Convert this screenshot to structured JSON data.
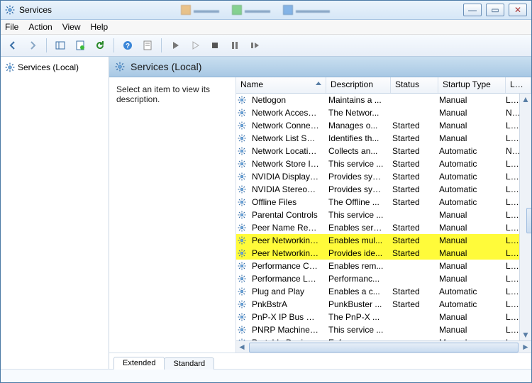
{
  "title": "Services",
  "menubar": [
    "File",
    "Action",
    "View",
    "Help"
  ],
  "tree": {
    "root": "Services (Local)"
  },
  "header": "Services (Local)",
  "desc": "Select an item to view its description.",
  "columns": [
    "Name",
    "Description",
    "Status",
    "Startup Type",
    "Log On As"
  ],
  "tabs": {
    "extended": "Extended",
    "standard": "Standard"
  },
  "services": [
    {
      "name": "Netlogon",
      "desc": "Maintains a ...",
      "status": "",
      "startup": "Manual",
      "logon": "Local Syste...",
      "hl": false
    },
    {
      "name": "Network Access P...",
      "desc": "The Networ...",
      "status": "",
      "startup": "Manual",
      "logon": "Network S...",
      "hl": false
    },
    {
      "name": "Network Connecti...",
      "desc": "Manages o...",
      "status": "Started",
      "startup": "Manual",
      "logon": "Local Syste...",
      "hl": false
    },
    {
      "name": "Network List Service",
      "desc": "Identifies th...",
      "status": "Started",
      "startup": "Manual",
      "logon": "Local Service",
      "hl": false
    },
    {
      "name": "Network Location ...",
      "desc": "Collects an...",
      "status": "Started",
      "startup": "Automatic",
      "logon": "Network S...",
      "hl": false
    },
    {
      "name": "Network Store Int...",
      "desc": "This service ...",
      "status": "Started",
      "startup": "Automatic",
      "logon": "Local Service",
      "hl": false
    },
    {
      "name": "NVIDIA Display Dri...",
      "desc": "Provides sys...",
      "status": "Started",
      "startup": "Automatic",
      "logon": "Local Syste...",
      "hl": false
    },
    {
      "name": "NVIDIA Stereosco...",
      "desc": "Provides sys...",
      "status": "Started",
      "startup": "Automatic",
      "logon": "Local Syste...",
      "hl": false
    },
    {
      "name": "Offline Files",
      "desc": "The Offline ...",
      "status": "Started",
      "startup": "Automatic",
      "logon": "Local Syste...",
      "hl": false
    },
    {
      "name": "Parental Controls",
      "desc": "This service ...",
      "status": "",
      "startup": "Manual",
      "logon": "Local Service",
      "hl": false
    },
    {
      "name": "Peer Name Resolu...",
      "desc": "Enables serv...",
      "status": "Started",
      "startup": "Manual",
      "logon": "Local Service",
      "hl": false
    },
    {
      "name": "Peer Networking ...",
      "desc": "Enables mul...",
      "status": "Started",
      "startup": "Manual",
      "logon": "Local Service",
      "hl": true
    },
    {
      "name": "Peer Networking I...",
      "desc": "Provides ide...",
      "status": "Started",
      "startup": "Manual",
      "logon": "Local Service",
      "hl": true
    },
    {
      "name": "Performance Cou...",
      "desc": "Enables rem...",
      "status": "",
      "startup": "Manual",
      "logon": "Local Service",
      "hl": false
    },
    {
      "name": "Performance Logs...",
      "desc": "Performanc...",
      "status": "",
      "startup": "Manual",
      "logon": "Local Service",
      "hl": false
    },
    {
      "name": "Plug and Play",
      "desc": "Enables a c...",
      "status": "Started",
      "startup": "Automatic",
      "logon": "Local Syste...",
      "hl": false
    },
    {
      "name": "PnkBstrA",
      "desc": "PunkBuster ...",
      "status": "Started",
      "startup": "Automatic",
      "logon": "Local Syste...",
      "hl": false
    },
    {
      "name": "PnP-X IP Bus Enu...",
      "desc": "The PnP-X ...",
      "status": "",
      "startup": "Manual",
      "logon": "Local Syste...",
      "hl": false
    },
    {
      "name": "PNRP Machine Na...",
      "desc": "This service ...",
      "status": "",
      "startup": "Manual",
      "logon": "Local Service",
      "hl": false
    },
    {
      "name": "Portable Device E...",
      "desc": "Enforces gr...",
      "status": "",
      "startup": "Manual",
      "logon": "Local Syste...",
      "hl": false
    }
  ]
}
